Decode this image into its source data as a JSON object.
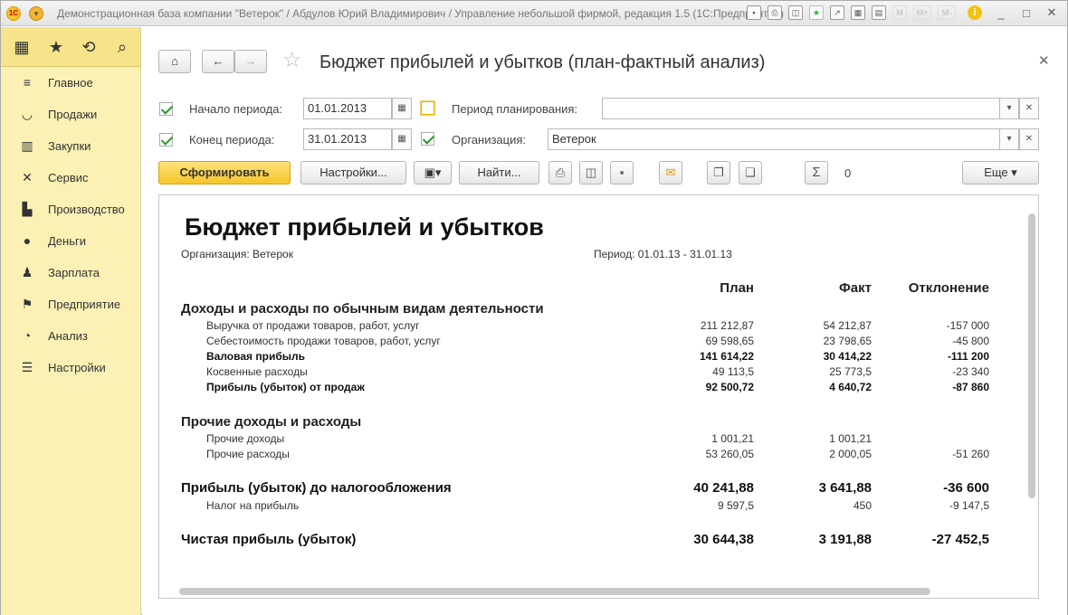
{
  "titlebar": {
    "title": "Демонстрационная база компании \"Ветерок\" / Абдулов Юрий Владимирович / Управление небольшой фирмой, редакция 1.5  (1С:Предприятие)",
    "logo": "1С",
    "mem_buttons": [
      "M",
      "M+",
      "M-"
    ]
  },
  "sidebar": {
    "items": [
      {
        "label": "Главное",
        "icon": "menu-lines-icon"
      },
      {
        "label": "Продажи",
        "icon": "basket-icon"
      },
      {
        "label": "Закупки",
        "icon": "cart-icon"
      },
      {
        "label": "Сервис",
        "icon": "tools-icon"
      },
      {
        "label": "Производство",
        "icon": "factory-icon"
      },
      {
        "label": "Деньги",
        "icon": "ruble-coin-icon"
      },
      {
        "label": "Зарплата",
        "icon": "people-icon"
      },
      {
        "label": "Предприятие",
        "icon": "flag-icon"
      },
      {
        "label": "Анализ",
        "icon": "pie-chart-icon"
      },
      {
        "label": "Настройки",
        "icon": "settings-list-icon"
      }
    ]
  },
  "form": {
    "title": "Бюджет прибылей и убытков (план-фактный анализ)",
    "period_start_label": "Начало периода:",
    "period_start_value": "01.01.2013",
    "period_end_label": "Конец периода:",
    "period_end_value": "31.01.2013",
    "planning_period_label": "Период планирования:",
    "planning_period_value": "",
    "organization_label": "Организация:",
    "organization_value": "Ветерок"
  },
  "toolbar": {
    "generate_label": "Сформировать",
    "settings_label": "Настройки...",
    "find_label": "Найти...",
    "sum_value": "0",
    "more_label": "Еще"
  },
  "report": {
    "title": "Бюджет прибылей и убытков",
    "org_line": "Организация: Ветерок",
    "period_line": "Период: 01.01.13 - 31.01.13",
    "col_plan": "План",
    "col_fact": "Факт",
    "col_dev": "Отклонение",
    "section1": {
      "title": "Доходы и расходы по обычным видам деятельности",
      "rows": [
        {
          "name": "Выручка от продажи товаров, работ, услуг",
          "plan": "211 212,87",
          "fact": "54 212,87",
          "dev": "-157 000",
          "bold": false
        },
        {
          "name": "Себестоимость продажи товаров, работ, услуг",
          "plan": "69 598,65",
          "fact": "23 798,65",
          "dev": "-45 800",
          "bold": false
        },
        {
          "name": "Валовая прибыль",
          "plan": "141 614,22",
          "fact": "30 414,22",
          "dev": "-111 200",
          "bold": true
        },
        {
          "name": "Косвенные расходы",
          "plan": "49 113,5",
          "fact": "25 773,5",
          "dev": "-23 340",
          "bold": false
        },
        {
          "name": "Прибыль (убыток) от продаж",
          "plan": "92 500,72",
          "fact": "4 640,72",
          "dev": "-87 860",
          "bold": true
        }
      ]
    },
    "section2": {
      "title": "Прочие доходы и расходы",
      "rows": [
        {
          "name": "Прочие доходы",
          "plan": "1 001,21",
          "fact": "1 001,21",
          "dev": ""
        },
        {
          "name": "Прочие расходы",
          "plan": "53 260,05",
          "fact": "2 000,05",
          "dev": "-51 260"
        }
      ]
    },
    "pretax": {
      "name": "Прибыль (убыток) до налогообложения",
      "plan": "40 241,88",
      "fact": "3 641,88",
      "dev": "-36 600"
    },
    "tax": {
      "name": "Налог на прибыль",
      "plan": "9 597,5",
      "fact": "450",
      "dev": "-9 147,5"
    },
    "net": {
      "name": "Чистая прибыль (убыток)",
      "plan": "30 644,38",
      "fact": "3 191,88",
      "dev": "-27 452,5"
    }
  }
}
